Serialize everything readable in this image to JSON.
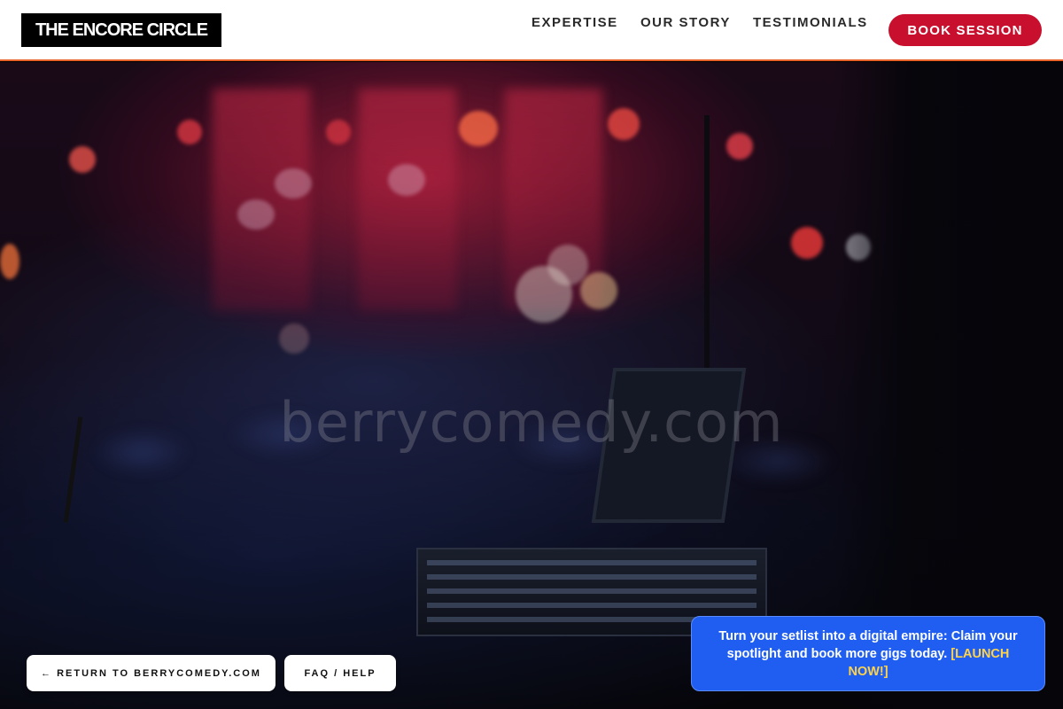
{
  "header": {
    "logo_text": "THE ENCORE CIRCLE",
    "nav": [
      {
        "label": "EXPERTISE"
      },
      {
        "label": "OUR STORY"
      },
      {
        "label": "TESTIMONIALS"
      }
    ],
    "book_label": "BOOK SESSION"
  },
  "hero": {
    "watermark": "berrycomedy.com"
  },
  "actions": {
    "return_label": "← RETURN TO BERRYCOMEDY.COM",
    "faq_label": "FAQ / HELP"
  },
  "cta": {
    "text": "Turn your setlist into a digital empire: Claim your spotlight and book more gigs today. ",
    "link_text": "[LAUNCH NOW!]"
  },
  "colors": {
    "header_border": "#e8622c",
    "book_button": "#c8102e",
    "cta_bg": "#1f5ef0",
    "cta_link": "#ffd44a"
  }
}
